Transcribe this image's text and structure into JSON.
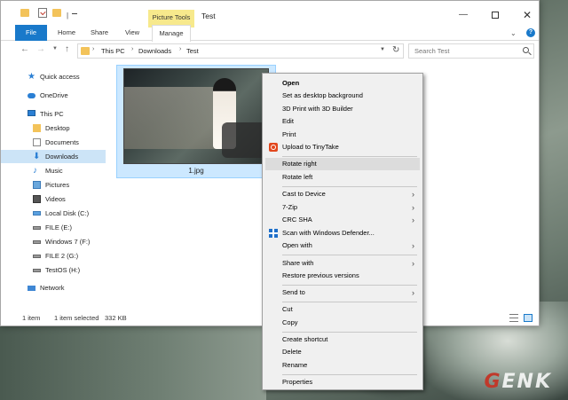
{
  "titlebar": {
    "picture_tools": "Picture Tools",
    "title": "Test",
    "minimize": "—",
    "close": "✕"
  },
  "ribbon": {
    "tabs": [
      "File",
      "Home",
      "Share",
      "View",
      "Manage"
    ],
    "chevron": "⌄",
    "help": "?"
  },
  "nav": {
    "back": "←",
    "forward": "→",
    "recent": "▼",
    "up": "↑",
    "breadcrumb": [
      "This PC",
      "Downloads",
      "Test"
    ],
    "crumb_sep": "›",
    "dropdown": "▼",
    "refresh": "↻",
    "search_placeholder": "Search Test"
  },
  "sidebar": {
    "items": [
      {
        "label": "Quick access",
        "icon": "star-icon"
      },
      {
        "label": "OneDrive",
        "icon": "cloud-icon"
      },
      {
        "label": "This PC",
        "icon": "computer-icon"
      },
      {
        "label": "Desktop",
        "icon": "folder-icon"
      },
      {
        "label": "Documents",
        "icon": "document-icon"
      },
      {
        "label": "Downloads",
        "icon": "download-icon",
        "selected": true
      },
      {
        "label": "Music",
        "icon": "music-icon"
      },
      {
        "label": "Pictures",
        "icon": "pictures-icon"
      },
      {
        "label": "Videos",
        "icon": "videos-icon"
      },
      {
        "label": "Local Disk (C:)",
        "icon": "windows-drive-icon"
      },
      {
        "label": "FILE (E:)",
        "icon": "drive-icon"
      },
      {
        "label": "Windows 7 (F:)",
        "icon": "drive-icon"
      },
      {
        "label": "FILE 2 (G:)",
        "icon": "drive-icon"
      },
      {
        "label": "TestOS (H:)",
        "icon": "drive-icon"
      },
      {
        "label": "Network",
        "icon": "network-icon"
      }
    ]
  },
  "content": {
    "file_name": "1.jpg"
  },
  "statusbar": {
    "count": "1 item",
    "selection": "1 item selected",
    "size": "332 KB"
  },
  "context_menu": {
    "items": [
      {
        "label": "Open",
        "bold": true
      },
      {
        "label": "Set as desktop background"
      },
      {
        "label": "3D Print with 3D Builder"
      },
      {
        "label": "Edit"
      },
      {
        "label": "Print"
      },
      {
        "label": "Upload to TinyTake",
        "icon": "tinytake-icon"
      },
      {
        "label": "Rotate right",
        "hover": true
      },
      {
        "label": "Rotate left"
      },
      {
        "label": "Cast to Device",
        "submenu": true
      },
      {
        "label": "7-Zip",
        "submenu": true
      },
      {
        "label": "CRC SHA",
        "submenu": true
      },
      {
        "label": "Scan with Windows Defender...",
        "icon": "windows-defender-icon"
      },
      {
        "label": "Open with",
        "submenu": true
      },
      {
        "label": "Share with",
        "submenu": true
      },
      {
        "label": "Restore previous versions"
      },
      {
        "label": "Send to",
        "submenu": true
      },
      {
        "label": "Cut"
      },
      {
        "label": "Copy"
      },
      {
        "label": "Create shortcut"
      },
      {
        "label": "Delete"
      },
      {
        "label": "Rename"
      },
      {
        "label": "Properties"
      }
    ],
    "arrow": "›"
  },
  "watermark": {
    "accent": "G",
    "rest": "ENK"
  }
}
